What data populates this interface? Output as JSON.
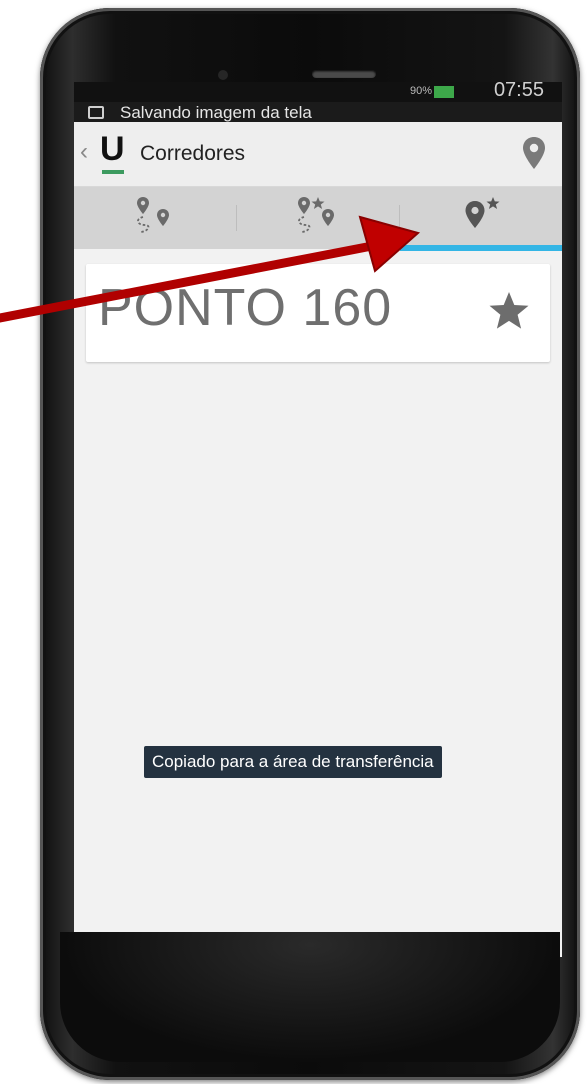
{
  "status_bar": {
    "battery": "90%",
    "time": "07:55"
  },
  "notification": {
    "text": "Salvando imagem da tela",
    "icon": "image-icon"
  },
  "action_bar": {
    "back_icon": "chevron-left-icon",
    "logo": "U",
    "title": "Corredores",
    "action_icon": "map-pin-icon"
  },
  "tabs": [
    {
      "icon": "route-icon",
      "selected": false
    },
    {
      "icon": "favorite-route-icon",
      "selected": false
    },
    {
      "icon": "favorite-stop-icon",
      "selected": true
    }
  ],
  "accent_color": "#33b5e5",
  "favorites": [
    {
      "title": "PONTO 160",
      "icon": "star-icon"
    }
  ],
  "toast": {
    "text": "Copiado para a área de transferência"
  },
  "annotation": {
    "color": "#c00000",
    "points_to": "favorite-stop-tab"
  }
}
